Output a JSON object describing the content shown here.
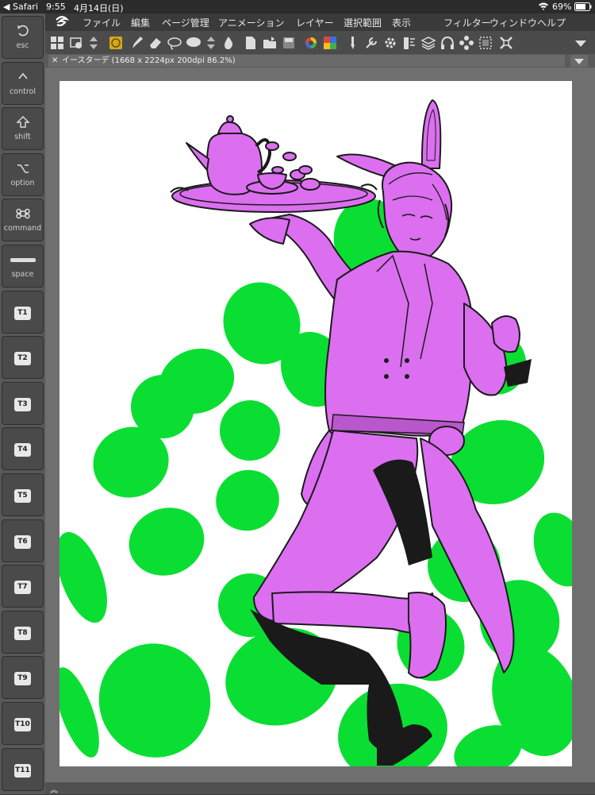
{
  "status_bar": {
    "back_app": "Safari",
    "time": "9:55",
    "date": "4月14日(日)",
    "battery": "69%"
  },
  "shortcut_keys": [
    {
      "label": "esc",
      "icon": "undo-arrow-icon"
    },
    {
      "label": "control",
      "icon": "caret-up-icon"
    },
    {
      "label": "shift",
      "icon": "shift-arrow-icon"
    },
    {
      "label": "option",
      "icon": "option-key-icon"
    },
    {
      "label": "command",
      "icon": "command-key-icon"
    },
    {
      "label": "space",
      "icon": "space-bar-icon"
    },
    {
      "label": "T1"
    },
    {
      "label": "T2"
    },
    {
      "label": "T3"
    },
    {
      "label": "T4"
    },
    {
      "label": "T5"
    },
    {
      "label": "T6"
    },
    {
      "label": "T7"
    },
    {
      "label": "T8"
    },
    {
      "label": "T9"
    },
    {
      "label": "T10"
    },
    {
      "label": "T11"
    }
  ],
  "menu": {
    "logo": "clip-studio-logo-icon",
    "items": [
      "ファイル",
      "編集",
      "ページ管理",
      "アニメーション",
      "レイヤー",
      "選択範囲",
      "表示",
      "フィルター",
      "ウィンドウ",
      "ヘルプ"
    ]
  },
  "toolbar": {
    "icons": [
      "grid-icon",
      "layer-icon",
      "up-down-icon",
      "color-set-icon",
      "pen-icon",
      "eraser-icon",
      "lasso-icon",
      "balloon-icon",
      "up-down-icon",
      "drop-icon",
      "new-file-icon",
      "open-icon",
      "save-icon",
      "color-wheel-icon",
      "color-palette-icon",
      "brush-icon",
      "wrench-icon",
      "gear-icon",
      "ruler-icon",
      "layers-icon",
      "headphones-icon",
      "flower-icon",
      "select-icon",
      "transform-icon"
    ]
  },
  "document_tab": {
    "title": "イースターデ (1668 x 2224px 200dpi 86.2%)"
  },
  "colors": {
    "egg_green": "#0bde33",
    "figure_purple": "#db6ff0",
    "ink": "#1a1a1a",
    "canvas_bg": "#ffffff"
  }
}
